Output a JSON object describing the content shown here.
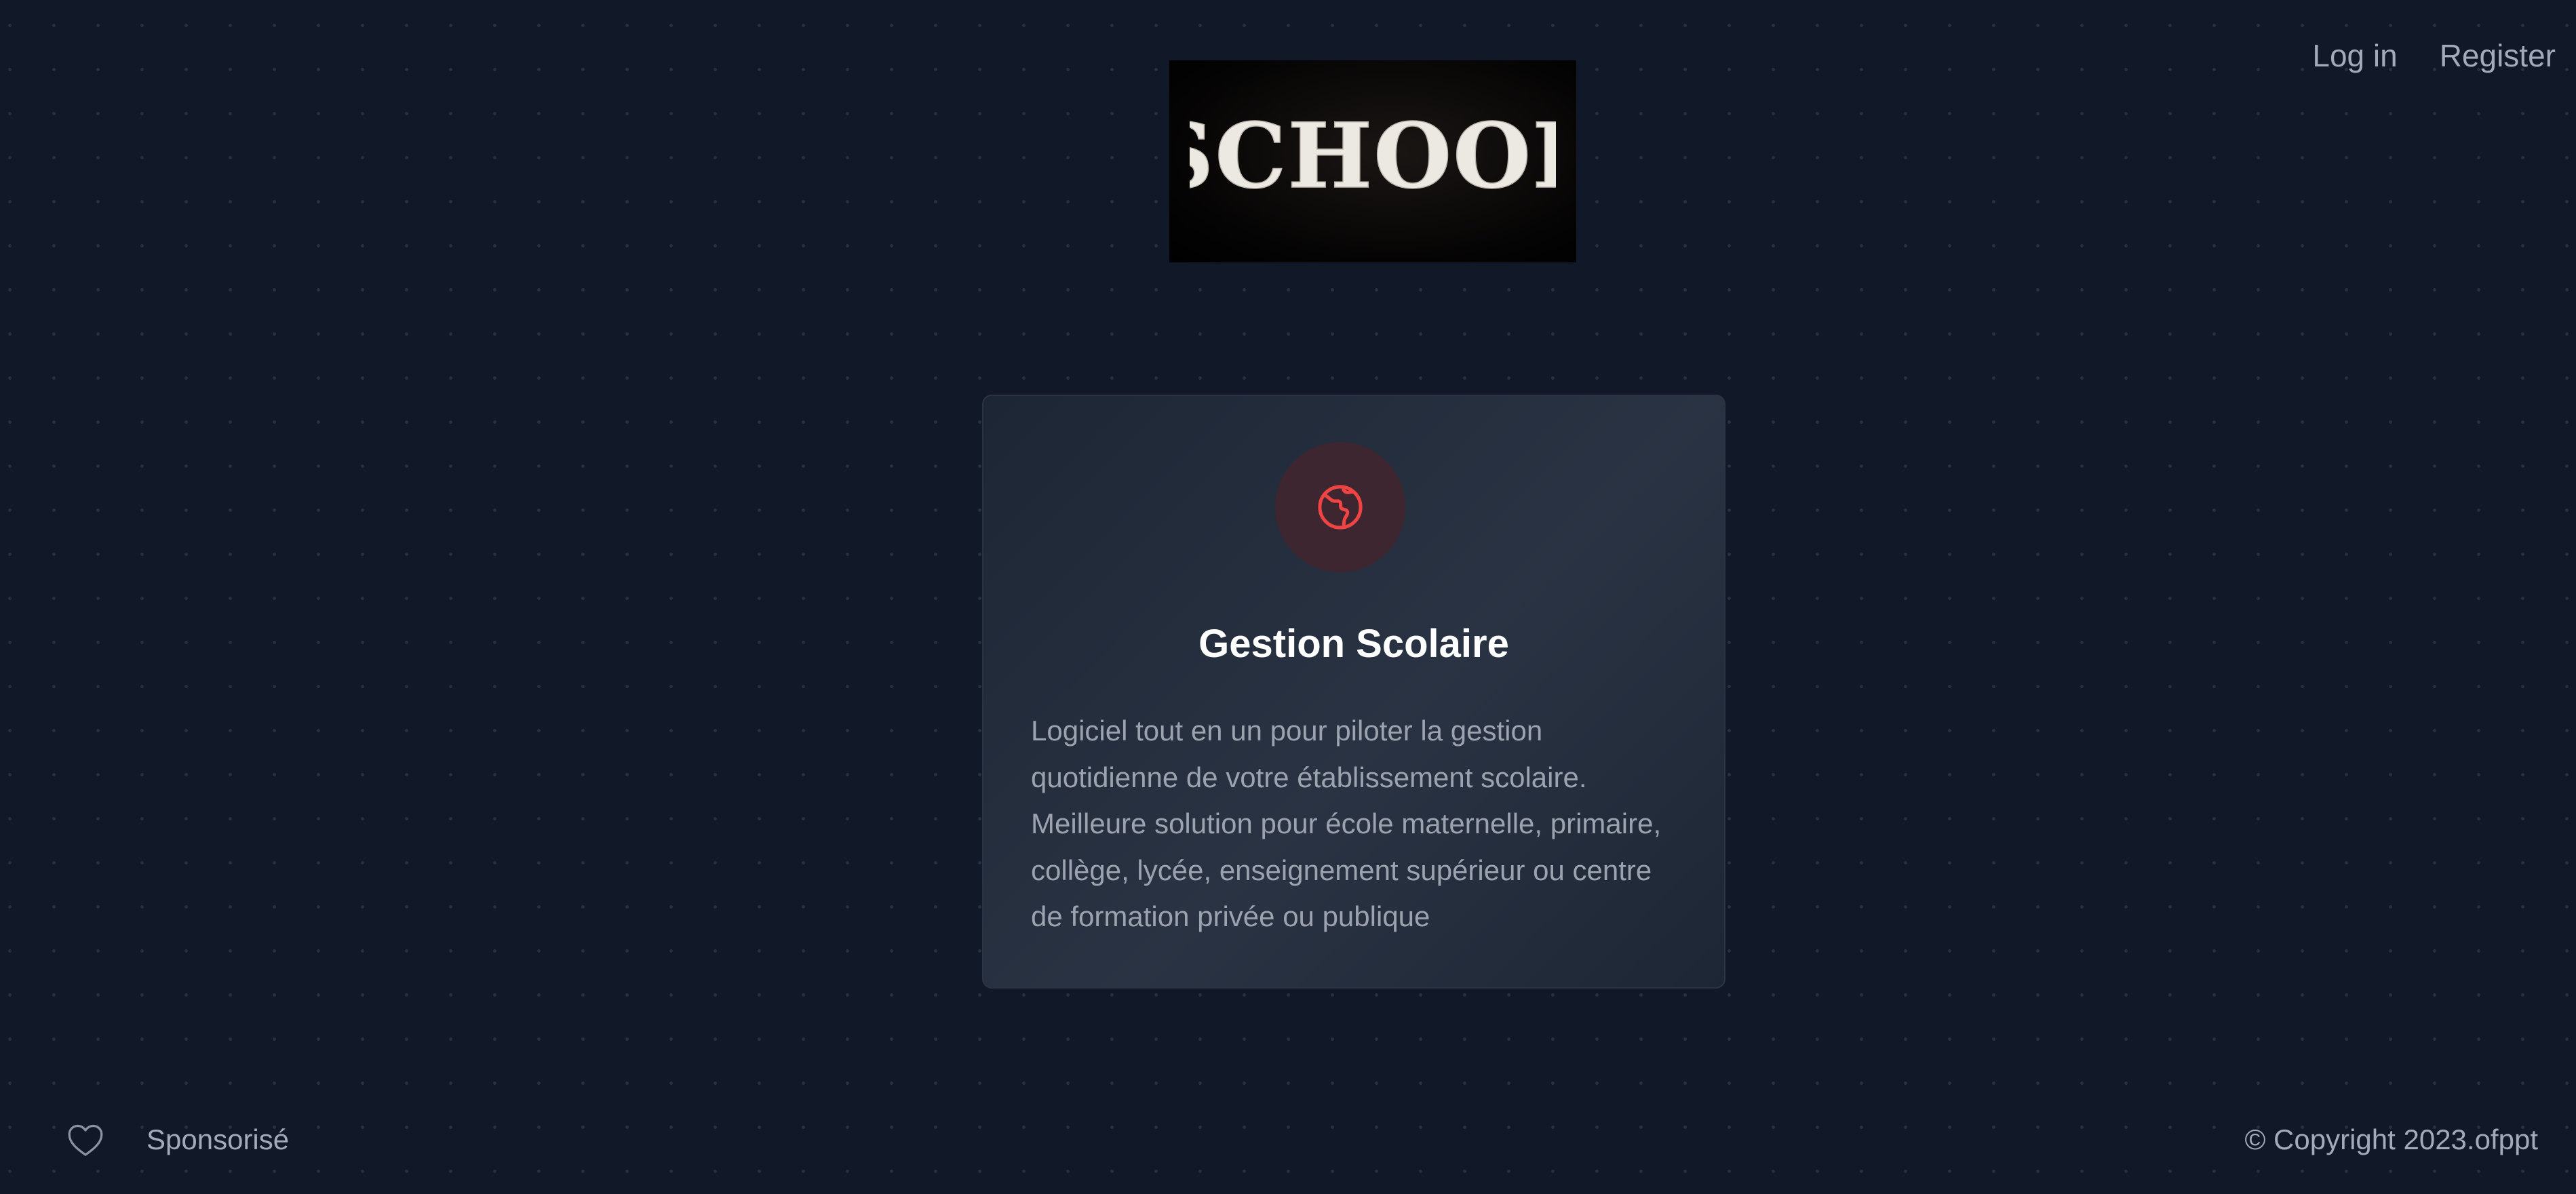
{
  "nav": {
    "login_label": "Log in",
    "register_label": "Register"
  },
  "logo": {
    "text": "SCHOOL"
  },
  "card": {
    "icon": "globe-icon",
    "title": "Gestion Scolaire",
    "description": "Logiciel tout en un pour piloter la gestion quotidienne de votre établissement scolaire. Meilleure solution pour école maternelle, primaire, collège, lycée, enseignement supérieur ou centre de formation privée ou publique"
  },
  "footer": {
    "heart_icon": "heart-icon",
    "sponsor_label": "Sponsorisé",
    "copyright": "© Copyright 2023.ofppt"
  },
  "colors": {
    "background": "#111827",
    "accent": "#ef4444",
    "muted_text": "#9ca3af"
  }
}
